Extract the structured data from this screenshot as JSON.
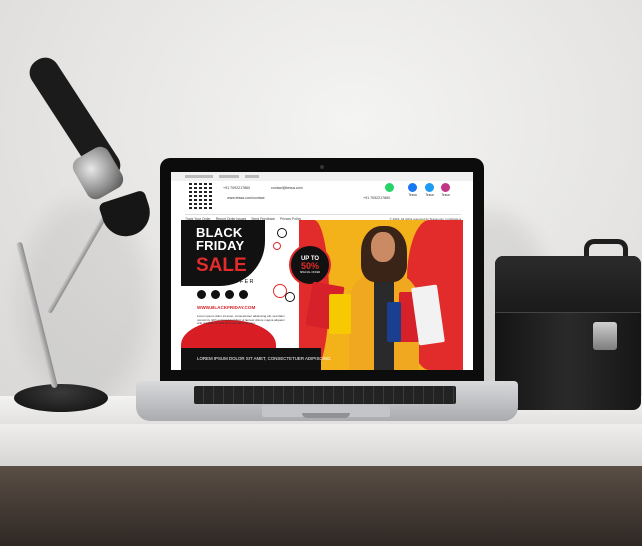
{
  "screen": {
    "header": {
      "phone": "+91 7092217860",
      "email": "contact@tessa.com",
      "url": "www.tessa.com/contact",
      "social_phone": "+91 7092217860",
      "social_labels": [
        "Tessa",
        "Tessa",
        "Tessa"
      ]
    },
    "nav": {
      "items": [
        "Track Your Order",
        "Report Order Issues",
        "Send Feedback",
        "Privacy Policy"
      ],
      "copyright": "© 2023, All rights reserved by Tessa.com | mrs/tools.a"
    },
    "banner": {
      "line1": "BLACK",
      "line2": "FRIDAY",
      "line3": "SALE",
      "limited": "LIMITED OFFER",
      "badge_top": "UP TO",
      "badge_value": "50%",
      "badge_bottom": "SPECIAL OFFER",
      "website": "WWW.BLACKFRIDAY.COM",
      "body": "Lorem ipsum dolor sit amet, consectetuer adipiscing elit, sed diam nonummy nibh euismod tincidunt ut laoreet dolore magna aliquam erat volutpat. Ut wisi enim ad minim veniam.",
      "footer": "LOREM IPSUM DOLOR SIT AMET, CONSECTETUER ADIPISCING."
    }
  },
  "colors": {
    "red": "#e22b2b",
    "yellow": "#f4b21a",
    "black": "#111111"
  }
}
